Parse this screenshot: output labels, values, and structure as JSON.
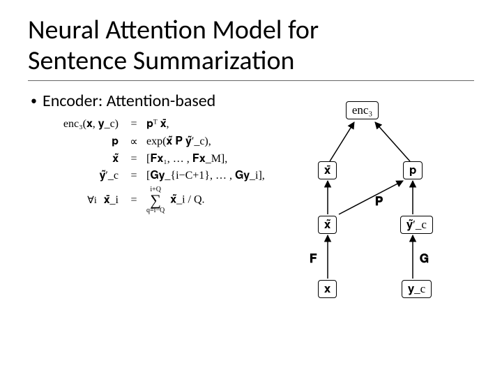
{
  "title_line1": "Neural Attention Model for",
  "title_line2": "Sentence Summarization",
  "bullet": "Encoder: Attention-based",
  "equations": {
    "row1": {
      "lhs": "enc₃(𝐱, 𝐲_c)",
      "op": "=",
      "rhs": "𝐩ᵀ 𝐱̄,"
    },
    "row2": {
      "lhs": "𝐩",
      "op": "∝",
      "rhs": "exp(𝐱̃ 𝐏 𝐲̃′_c),"
    },
    "row3": {
      "lhs": "𝐱̃",
      "op": "=",
      "rhs": "[𝐅𝐱₁, … , 𝐅𝐱_M],"
    },
    "row4": {
      "lhs": "𝐲̃′_c",
      "op": "=",
      "rhs": "[𝐆𝐲_{i−C+1}, … , 𝐆𝐲_i],"
    },
    "row5": {
      "prefix": "∀i",
      "lhs": "𝐱̄_i",
      "op": "=",
      "sum_top": "i+Q",
      "sum_bot": "q=i−Q",
      "rhs_tail": "𝐱̃_i / Q."
    }
  },
  "graph": {
    "nodes": {
      "enc3": "enc₃",
      "xbar": "𝐱̄",
      "p": "𝐩",
      "xtilde": "𝐱̃",
      "ytilde": "𝐲̃′_c",
      "x": "𝐱",
      "yc": "𝐲_c"
    },
    "edge_labels": {
      "P": "𝐏",
      "F": "𝐅",
      "G": "𝐆"
    }
  }
}
